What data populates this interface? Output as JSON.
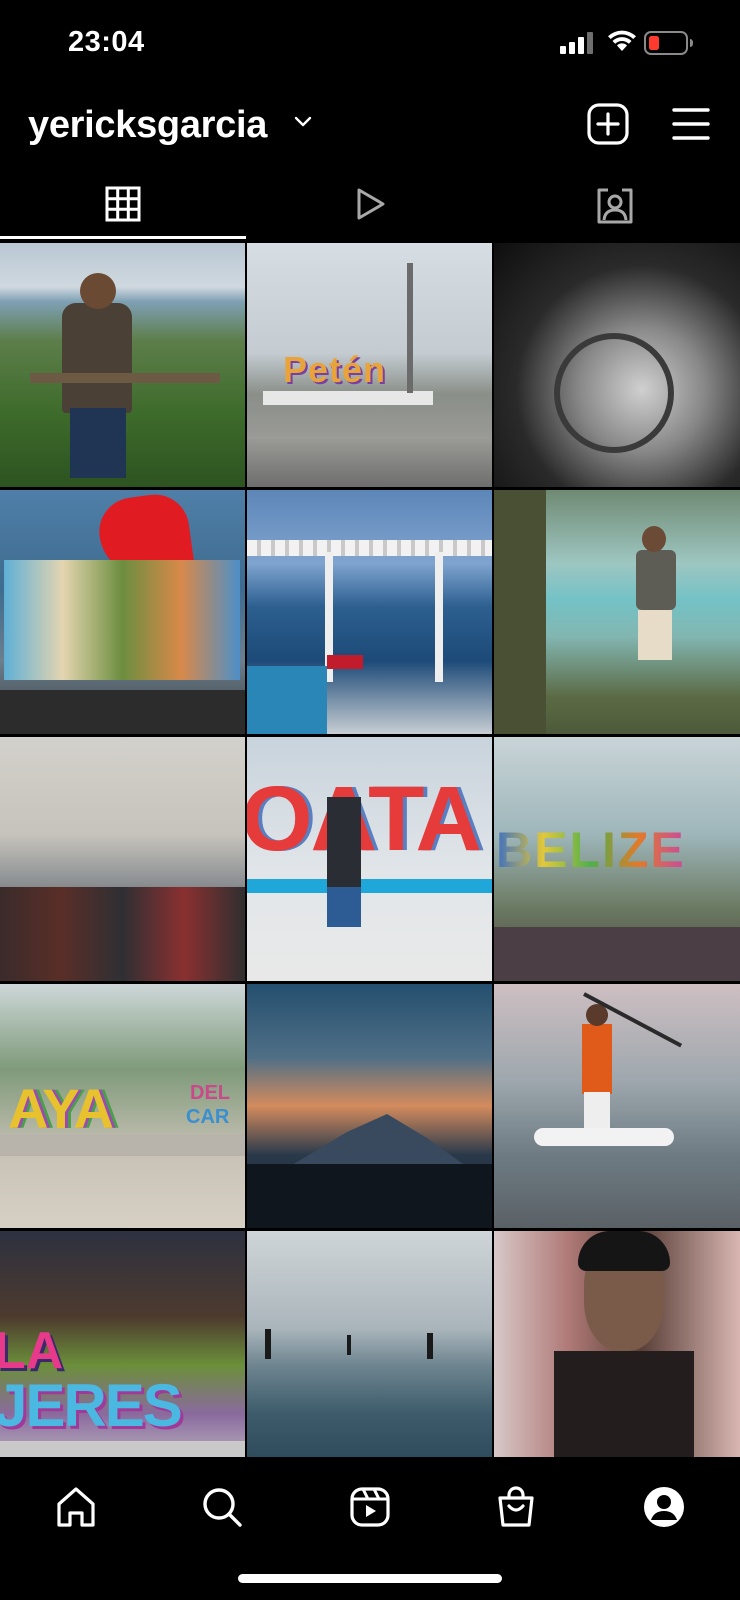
{
  "status_bar": {
    "time": "23:04",
    "icons": [
      "cellular-signal-icon",
      "wifi-icon",
      "battery-low-icon"
    ]
  },
  "header": {
    "username": "yericksgarcia",
    "icons": [
      "chevron-down-icon",
      "add-post-icon",
      "menu-icon"
    ]
  },
  "tabs": [
    {
      "name": "posts-grid",
      "icon": "grid-icon",
      "selected": true
    },
    {
      "name": "reels",
      "icon": "reels-play-icon",
      "selected": false
    },
    {
      "name": "tagged",
      "icon": "tagged-person-icon",
      "selected": false
    }
  ],
  "posts": [
    {
      "kind": "photo",
      "texts": []
    },
    {
      "kind": "photo",
      "texts": [
        "Petén"
      ]
    },
    {
      "kind": "photo",
      "texts": []
    },
    {
      "kind": "photo",
      "texts": []
    },
    {
      "kind": "photo",
      "texts": []
    },
    {
      "kind": "photo",
      "texts": []
    },
    {
      "kind": "photo",
      "texts": []
    },
    {
      "kind": "photo",
      "texts": [
        "OATA"
      ]
    },
    {
      "kind": "photo",
      "texts": [
        "BELIZE"
      ]
    },
    {
      "kind": "photo",
      "texts": [
        "AYA",
        "DEL",
        "CAR"
      ]
    },
    {
      "kind": "photo",
      "texts": []
    },
    {
      "kind": "photo",
      "texts": []
    },
    {
      "kind": "photo",
      "texts": [
        "LA",
        "JERES"
      ]
    },
    {
      "kind": "photo",
      "texts": []
    },
    {
      "kind": "photo",
      "texts": []
    }
  ],
  "bottom_nav": [
    {
      "name": "home",
      "icon": "home-icon"
    },
    {
      "name": "search",
      "icon": "search-icon"
    },
    {
      "name": "reels",
      "icon": "reels-icon"
    },
    {
      "name": "shop",
      "icon": "shopping-bag-icon"
    },
    {
      "name": "profile",
      "icon": "profile-icon"
    }
  ],
  "colors": {
    "background": "#000000",
    "foreground": "#ffffff",
    "battery_low": "#ff3b30"
  }
}
